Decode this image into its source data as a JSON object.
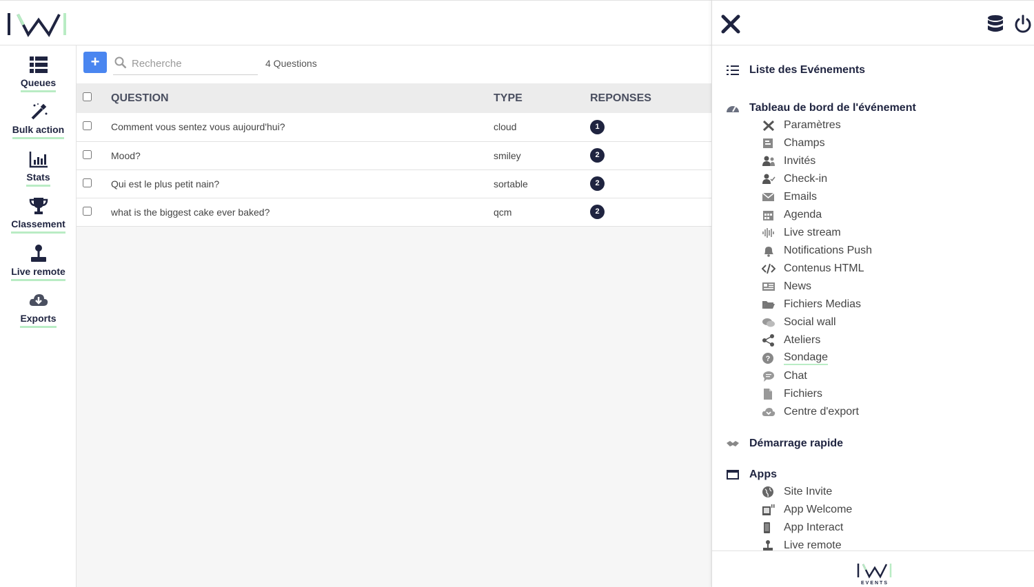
{
  "nav": {
    "items": [
      {
        "label": "Queues",
        "icon": "queues-icon"
      },
      {
        "label": "Bulk action",
        "icon": "magic-wand-icon"
      },
      {
        "label": "Stats",
        "icon": "bar-chart-icon"
      },
      {
        "label": "Classement",
        "icon": "trophy-icon"
      },
      {
        "label": "Live remote",
        "icon": "joystick-icon"
      },
      {
        "label": "Exports",
        "icon": "cloud-download-icon"
      }
    ]
  },
  "toolbar": {
    "add_label": "+",
    "search_placeholder": "Recherche",
    "count_label": "4 Questions"
  },
  "table": {
    "headers": {
      "question": "QUESTION",
      "type": "TYPE",
      "responses": "REPONSES"
    },
    "rows": [
      {
        "question": "Comment vous sentez vous aujourd'hui?",
        "type": "cloud",
        "responses": "1"
      },
      {
        "question": "Mood?",
        "type": "smiley",
        "responses": "2"
      },
      {
        "question": "Qui est le plus petit nain?",
        "type": "sortable",
        "responses": "2"
      },
      {
        "question": "what is the biggest cake ever baked?",
        "type": "qcm",
        "responses": "2"
      }
    ]
  },
  "panel": {
    "events_list": "Liste des Evénements",
    "dashboard": "Tableau de bord de l'événement",
    "dashboard_items": [
      {
        "label": "Paramètres",
        "icon": "tools-icon"
      },
      {
        "label": "Champs",
        "icon": "form-icon"
      },
      {
        "label": "Invités",
        "icon": "users-icon"
      },
      {
        "label": "Check-in",
        "icon": "user-check-icon"
      },
      {
        "label": "Emails",
        "icon": "envelope-icon"
      },
      {
        "label": "Agenda",
        "icon": "calendar-icon"
      },
      {
        "label": "Live stream",
        "icon": "waveform-icon"
      },
      {
        "label": "Notifications Push",
        "icon": "bell-icon"
      },
      {
        "label": "Contenus HTML",
        "icon": "code-icon"
      },
      {
        "label": "News",
        "icon": "newspaper-icon"
      },
      {
        "label": "Fichiers Medias",
        "icon": "folder-open-icon"
      },
      {
        "label": "Social wall",
        "icon": "comments-icon"
      },
      {
        "label": "Ateliers",
        "icon": "share-icon"
      },
      {
        "label": "Sondage",
        "icon": "question-circle-icon"
      },
      {
        "label": "Chat",
        "icon": "chat-bubble-icon"
      },
      {
        "label": "Fichiers",
        "icon": "file-icon"
      },
      {
        "label": "Centre d'export",
        "icon": "cloud-download-icon"
      }
    ],
    "quickstart": "Démarrage rapide",
    "apps": "Apps",
    "apps_items": [
      {
        "label": "Site Invite",
        "icon": "globe-icon"
      },
      {
        "label": "App Welcome",
        "icon": "tablet-icon"
      },
      {
        "label": "App Interact",
        "icon": "mobile-icon"
      },
      {
        "label": "Live remote",
        "icon": "joystick-icon"
      }
    ],
    "footer_logo_text": "EVENTS"
  },
  "colors": {
    "primary": "#1f2440",
    "accent_underline": "#b9ecc4",
    "add_button": "#4a86f0"
  }
}
